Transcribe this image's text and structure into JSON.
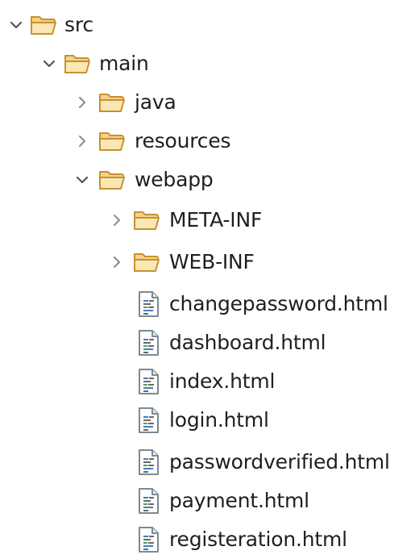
{
  "tree": {
    "src": {
      "label": "src",
      "expanded": true,
      "icon": "folder-open-icon"
    },
    "main": {
      "label": "main",
      "expanded": true,
      "icon": "folder-open-icon"
    },
    "java": {
      "label": "java",
      "expanded": false,
      "icon": "folder-icon"
    },
    "resources": {
      "label": "resources",
      "expanded": false,
      "icon": "folder-icon"
    },
    "webapp": {
      "label": "webapp",
      "expanded": true,
      "icon": "folder-open-icon"
    },
    "meta_inf": {
      "label": "META-INF",
      "expanded": false,
      "icon": "folder-icon"
    },
    "web_inf": {
      "label": "WEB-INF",
      "expanded": false,
      "icon": "folder-icon"
    },
    "files": [
      {
        "label": "changepassword.html",
        "icon": "html-file-icon"
      },
      {
        "label": "dashboard.html",
        "icon": "html-file-icon"
      },
      {
        "label": "index.html",
        "icon": "html-file-icon"
      },
      {
        "label": "login.html",
        "icon": "html-file-icon"
      },
      {
        "label": "passwordverified.html",
        "icon": "html-file-icon"
      },
      {
        "label": "payment.html",
        "icon": "html-file-icon"
      },
      {
        "label": "registeration.html",
        "icon": "html-file-icon"
      }
    ]
  },
  "colors": {
    "folder_fill": "#f5d89a",
    "folder_stroke": "#c8912e",
    "twisty": "#7a7a7a",
    "text": "#1f1f1f"
  }
}
